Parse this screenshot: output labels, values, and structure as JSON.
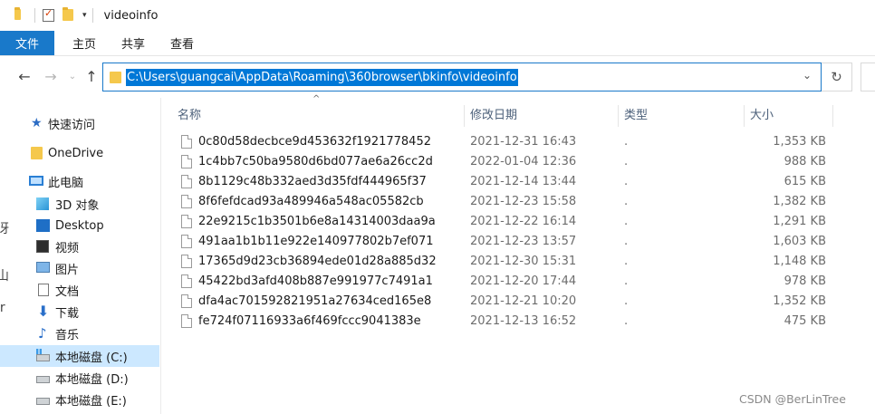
{
  "window": {
    "title": "videoinfo"
  },
  "ribbon": {
    "tabs": [
      "文件",
      "主页",
      "共享",
      "查看"
    ]
  },
  "address": {
    "path": "C:\\Users\\guangcai\\AppData\\Roaming\\360browser\\bkinfo\\videoinfo"
  },
  "sidebar": {
    "items": [
      {
        "label": "快速访问",
        "icon": "star-icon"
      },
      {
        "label": "OneDrive",
        "icon": "folder-icon"
      },
      {
        "label": "此电脑",
        "icon": "computer-icon"
      },
      {
        "label": "3D 对象",
        "icon": "cube-icon"
      },
      {
        "label": "Desktop",
        "icon": "desktop-icon"
      },
      {
        "label": "视频",
        "icon": "video-icon"
      },
      {
        "label": "图片",
        "icon": "picture-icon"
      },
      {
        "label": "文档",
        "icon": "document-icon"
      },
      {
        "label": "下载",
        "icon": "download-icon"
      },
      {
        "label": "音乐",
        "icon": "music-icon"
      },
      {
        "label": "本地磁盘 (C:)",
        "icon": "drive-c-icon"
      },
      {
        "label": "本地磁盘 (D:)",
        "icon": "drive-icon"
      },
      {
        "label": "本地磁盘 (E:)",
        "icon": "drive-icon"
      }
    ],
    "selected_index": 10,
    "edge_chars": [
      "冴",
      "山",
      "lr"
    ]
  },
  "columns": {
    "name": "名称",
    "date": "修改日期",
    "type": "类型",
    "size": "大小"
  },
  "files": [
    {
      "name": "0c80d58decbce9d453632f1921778452",
      "date": "2021-12-31 16:43",
      "type": ".",
      "size": "1,353 KB"
    },
    {
      "name": "1c4bb7c50ba9580d6bd077ae6a26cc2d",
      "date": "2022-01-04 12:36",
      "type": ".",
      "size": "988 KB"
    },
    {
      "name": "8b1129c48b332aed3d35fdf444965f37",
      "date": "2021-12-14 13:44",
      "type": ".",
      "size": "615 KB"
    },
    {
      "name": "8f6fefdcad93a489946a548ac05582cb",
      "date": "2021-12-23 15:58",
      "type": ".",
      "size": "1,382 KB"
    },
    {
      "name": "22e9215c1b3501b6e8a14314003daa9a",
      "date": "2021-12-22 16:14",
      "type": ".",
      "size": "1,291 KB"
    },
    {
      "name": "491aa1b1b11e922e140977802b7ef071",
      "date": "2021-12-23 13:57",
      "type": ".",
      "size": "1,603 KB"
    },
    {
      "name": "17365d9d23cb36894ede01d28a885d32",
      "date": "2021-12-30 15:31",
      "type": ".",
      "size": "1,148 KB"
    },
    {
      "name": "45422bd3afd408b887e991977c7491a1",
      "date": "2021-12-20 17:44",
      "type": ".",
      "size": "978 KB"
    },
    {
      "name": "dfa4ac70159282195 1a27634ced165e8",
      "date": "2021-12-21 10:20",
      "type": ".",
      "size": "1,352 KB"
    },
    {
      "name": "fe724f07116933a6f469fccc9041383e",
      "date": "2021-12-13 16:52",
      "type": ".",
      "size": "475 KB"
    }
  ],
  "watermark": "CSDN @BerLinTree",
  "colors": {
    "accent": "#1979ca",
    "selection": "#0078d7",
    "sidebar_selected": "#cce8ff"
  }
}
